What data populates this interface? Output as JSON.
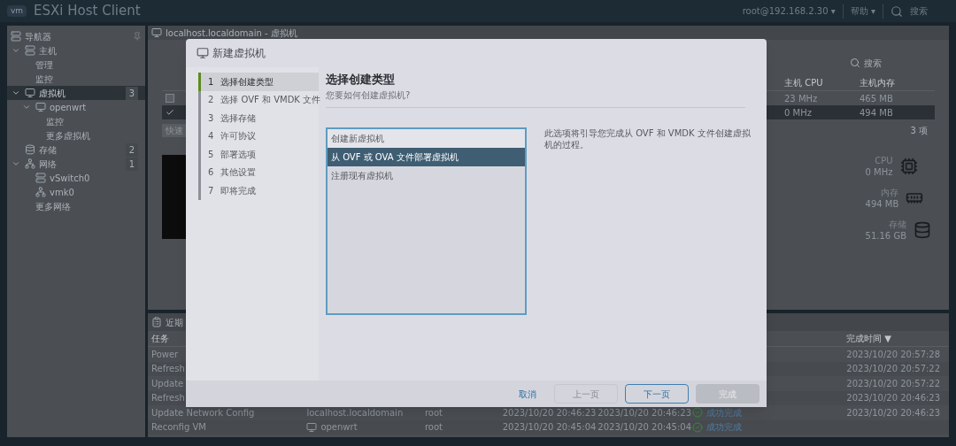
{
  "header": {
    "title": "ESXi Host Client",
    "logo": "vm",
    "user": "root@192.168.2.30",
    "caret": "▾",
    "help": "帮助",
    "search": "搜索"
  },
  "navigator": {
    "title": "导航器",
    "items": [
      {
        "label": "主机",
        "kind": "host",
        "selected": false,
        "expanded": true,
        "children": [
          {
            "label": "管理",
            "selected": false
          },
          {
            "label": "监控",
            "selected": false
          }
        ]
      },
      {
        "label": "虚拟机",
        "kind": "vm",
        "badge": "3",
        "selected": true,
        "expanded": true,
        "children": [
          {
            "label": "openwrt",
            "kind": "vm",
            "selected": false,
            "expanded": true,
            "children": [
              {
                "label": "监控",
                "selected": false
              },
              {
                "label": "更多虚拟机",
                "selected": false
              }
            ]
          }
        ]
      },
      {
        "label": "存储",
        "kind": "storage",
        "badge": "2",
        "selected": false
      },
      {
        "label": "网络",
        "kind": "network",
        "badge": "1",
        "selected": false,
        "expanded": true,
        "children": [
          {
            "label": "vSwitch0",
            "kind": "switch",
            "selected": false
          },
          {
            "label": "vmk0",
            "kind": "nic",
            "selected": false
          },
          {
            "label": "更多网络",
            "selected": false
          }
        ]
      }
    ]
  },
  "vm_panel": {
    "title": "localhost.localdomain - 虚拟机",
    "search": "搜索",
    "columns": [
      "主机 CPU",
      "主机内存"
    ],
    "rows": [
      {
        "checked": false,
        "selected": false,
        "cells": [
          "23 MHz",
          "465 MB"
        ]
      },
      {
        "checked": true,
        "selected": true,
        "cells": [
          "0 MHz",
          "494 MB"
        ]
      }
    ],
    "filter": "快速",
    "count": "3 项",
    "resources": [
      {
        "kind": "cpu",
        "label": "CPU",
        "value": "0 MHz"
      },
      {
        "kind": "memory",
        "label": "内存",
        "value": "494 MB"
      },
      {
        "kind": "storage",
        "label": "存储",
        "value": "51.16 GB"
      }
    ]
  },
  "tasks_panel": {
    "title": "近期",
    "columns": {
      "task": "任务",
      "completed": "完成时间 ▼"
    },
    "rows": [
      {
        "task": "Power",
        "completed": "2023/10/20 20:57:28"
      },
      {
        "task": "Refresh",
        "completed": "2023/10/20 20:57:22"
      },
      {
        "task": "Update",
        "completed": "2023/10/20 20:57:22"
      },
      {
        "task": "Refresh",
        "completed": "2023/10/20 20:46:23"
      },
      {
        "task": "Update Network Config",
        "target": "localhost.localdomain",
        "initiator": "root",
        "queued": "2023/10/20 20:46:23",
        "started": "2023/10/20 20:46:23",
        "result": "成功完成",
        "completed": "2023/10/20 20:46:23"
      },
      {
        "task": "Reconfig VM",
        "target": "openwrt",
        "target_icon": true,
        "initiator": "root",
        "queued": "2023/10/20 20:45:04",
        "started": "2023/10/20 20:45:04",
        "result": "成功完成"
      }
    ]
  },
  "dialog": {
    "title": "新建虚拟机",
    "steps": [
      {
        "number": "1",
        "label": "选择创建类型",
        "selected": true
      },
      {
        "number": "2",
        "label": "选择 OVF 和 VMDK 文件",
        "selected": false
      },
      {
        "number": "3",
        "label": "选择存储",
        "selected": false
      },
      {
        "number": "4",
        "label": "许可协议",
        "selected": false
      },
      {
        "number": "5",
        "label": "部署选项",
        "selected": false
      },
      {
        "number": "6",
        "label": "其他设置",
        "selected": false
      },
      {
        "number": "7",
        "label": "即将完成",
        "selected": false
      }
    ],
    "heading": "选择创建类型",
    "subheading": "您要如何创建虚拟机?",
    "options": [
      {
        "label": "创建新虚拟机",
        "selected": false
      },
      {
        "label": "从 OVF 或 OVA 文件部署虚拟机",
        "selected": true
      },
      {
        "label": "注册现有虚拟机",
        "selected": false
      }
    ],
    "description": "此选项将引导您完成从 OVF 和 VMDK 文件创建虚拟机的过程。",
    "buttons": [
      {
        "kind": "link",
        "label": "取消",
        "disabled": false
      },
      {
        "kind": "outline",
        "label": "上一页",
        "disabled": true
      },
      {
        "kind": "outline",
        "label": "下一页",
        "disabled": false
      },
      {
        "kind": "primary",
        "label": "完成",
        "disabled": true
      }
    ]
  }
}
